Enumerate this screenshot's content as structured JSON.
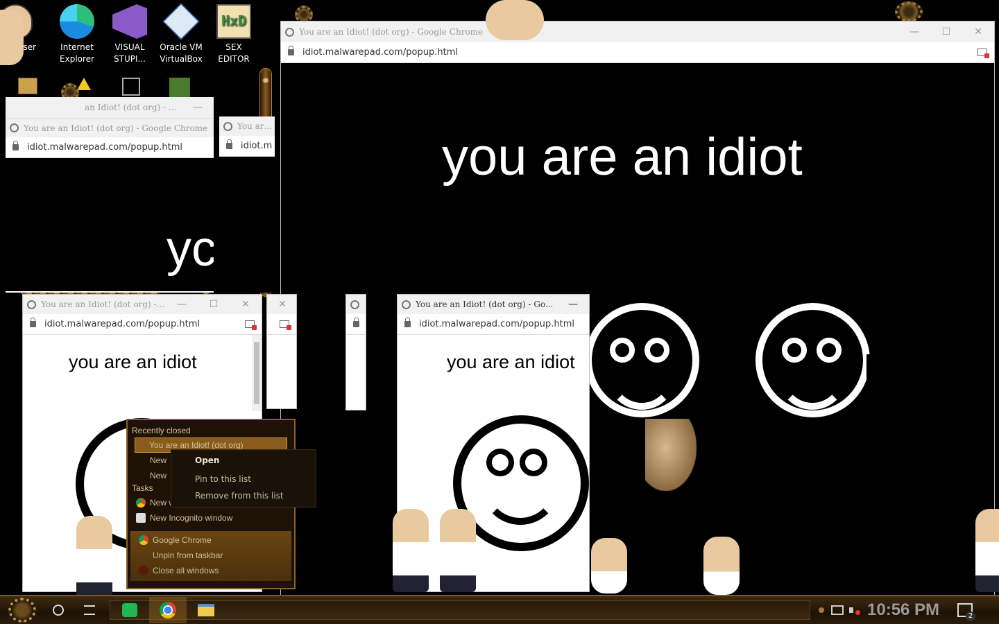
{
  "desktop": {
    "icons": [
      {
        "label": "User",
        "icon": "user-icon"
      },
      {
        "label": "Internet\nExplorer",
        "icon": "edge-icon"
      },
      {
        "label": "VISUAL\nSTUPI...",
        "icon": "visual-studio-icon"
      },
      {
        "label": "Oracle VM\nVirtualBox",
        "icon": "virtualbox-icon"
      },
      {
        "label": "SEX\nEDITOR",
        "icon": "hex-editor-icon"
      }
    ]
  },
  "popup": {
    "title": "You are an Idiot! (dot org) - Google Chrome",
    "title_short": "You are an Idiot! (dot org) - Go...",
    "title_tiny": "an Idiot! (dot org) - Go...",
    "title_cut": "You are a",
    "url": "idiot.malwarepad.com/popup.html",
    "url_cut": "idiot.m",
    "message": "you are an idiot",
    "message_cut": "yc",
    "colors": {
      "dark_bg": "#000000",
      "light_bg": "#ffffff"
    }
  },
  "jumplist": {
    "recently_closed_header": "Recently closed",
    "recent_items": [
      "You are an Idiot! (dot org)",
      "New",
      "New"
    ],
    "tasks_header": "Tasks",
    "tasks": [
      "New window",
      "New Incognito window"
    ],
    "app_items": [
      "Google Chrome",
      "Unpin from taskbar",
      "Close all windows"
    ]
  },
  "context_menu": {
    "items": [
      "Open",
      "Pin to this list",
      "Remove from this list"
    ]
  },
  "taskbar": {
    "clock": "10:56 PM",
    "notification_count": "2",
    "icons": [
      "start-orb-icon",
      "search-circle-icon",
      "task-view-icon",
      "spotify-icon",
      "chrome-icon",
      "file-explorer-icon"
    ]
  }
}
